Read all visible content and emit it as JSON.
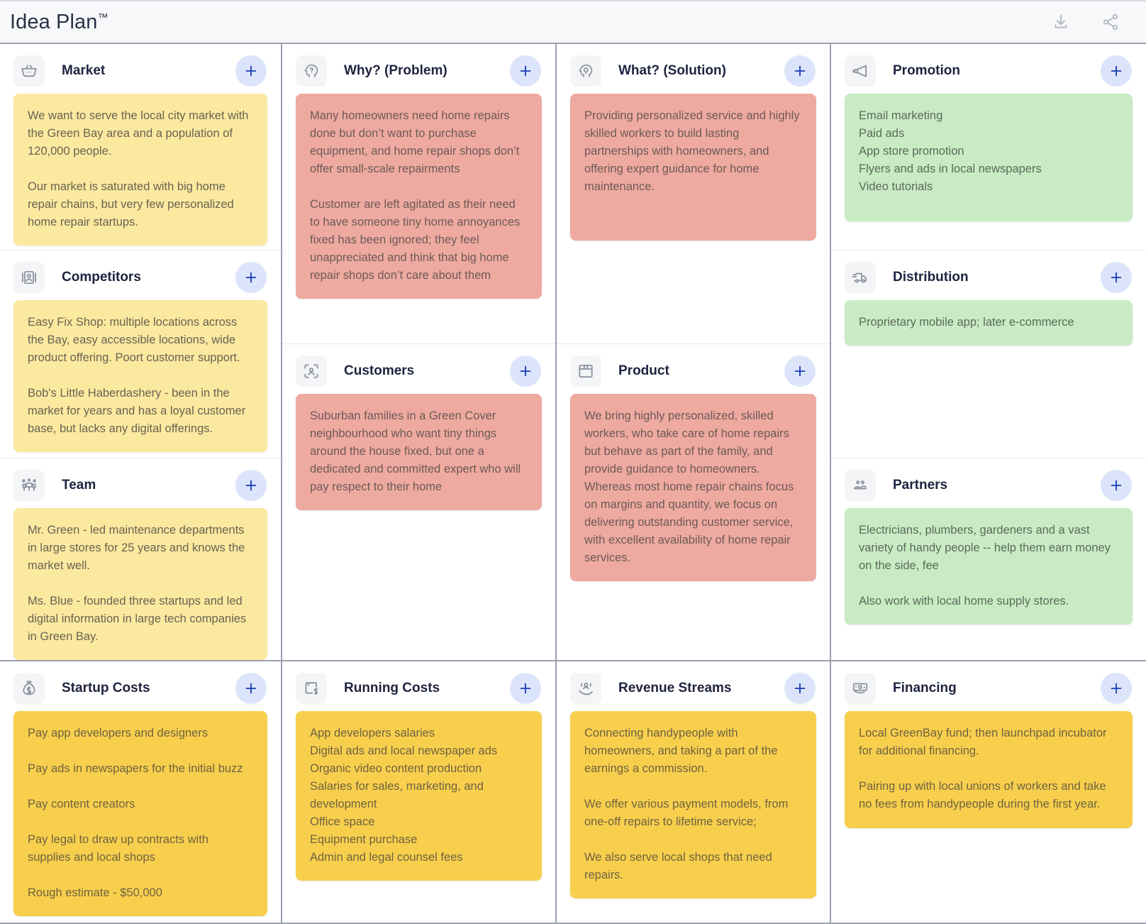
{
  "header": {
    "title": "Idea Plan",
    "trademark": "™",
    "actions": [
      {
        "name": "download-icon",
        "label": "Download"
      },
      {
        "name": "share-icon",
        "label": "Share"
      }
    ]
  },
  "add_button_label": "+",
  "colors": {
    "yellow_note": "#fbe9a0",
    "red_note": "#eeaaa0",
    "green_note": "#c8ebc4",
    "gold_note": "#f8cf4d",
    "add_button_bg": "#dbe4fa",
    "add_button_fg": "#1b3bb5",
    "title_text": "#1e2340",
    "page_bg": "#f7f8fa",
    "grid_line": "#9ba0ae"
  },
  "columns": [
    {
      "id": "col-1",
      "sections": [
        {
          "id": "market",
          "title": "Market",
          "icon": "basket-icon",
          "note_color": "yellow",
          "note": "We want to serve the local city market with the Green Bay area and a population of 120,000 people.\n\nOur market is saturated with big home repair chains, but very few personalized home repair startups."
        },
        {
          "id": "competitors",
          "title": "Competitors",
          "icon": "id-card-icon",
          "note_color": "yellow",
          "note": "Easy Fix Shop: multiple locations across the Bay, easy accessible locations, wide product offering. Poort customer support.\n\nBob's Little Haberdashery - been in the market for years and has a loyal customer base, but lacks any digital offerings."
        },
        {
          "id": "team",
          "title": "Team",
          "icon": "team-icon",
          "note_color": "yellow",
          "note": "Mr. Green - led maintenance departments in large stores for 25 years and knows the market well.\n\nMs. Blue - founded three startups and led digital information in large tech companies in Green Bay."
        }
      ]
    },
    {
      "id": "col-2",
      "sections": [
        {
          "id": "why-problem",
          "title": "Why? (Problem)",
          "icon": "head-question-icon",
          "note_color": "red",
          "note": "Many homeowners need home repairs done but don’t want to purchase equipment, and home repair shops don’t offer small-scale repairments\n\nCustomer are left agitated as their need to have someone tiny home annoyances fixed has been ignored; they feel unappreciated and think that big home repair shops don’t care about them"
        },
        {
          "id": "customers",
          "title": "Customers",
          "icon": "customer-scan-icon",
          "note_color": "red",
          "note": "Suburban families in a Green Cover neighbourhood who want tiny things around the house fixed, but one a dedicated and committed expert who will pay respect to their home"
        }
      ]
    },
    {
      "id": "col-3",
      "sections": [
        {
          "id": "what-solution",
          "title": "What? (Solution)",
          "icon": "head-idea-icon",
          "note_color": "red",
          "note": "Providing personalized service and highly skilled workers to build lasting partnerships with homeowners, and offering expert guidance for home maintenance."
        },
        {
          "id": "product",
          "title": "Product",
          "icon": "box-icon",
          "note_color": "red",
          "note": "We bring highly personalized, skilled workers, who take care of home repairs but behave as part of the family, and provide guidance to homeowners. Whereas most home repair chains focus on margins and quantity, we focus on delivering outstanding customer service, with excellent availability of home repair services."
        }
      ]
    },
    {
      "id": "col-4",
      "sections": [
        {
          "id": "promotion",
          "title": "Promotion",
          "icon": "megaphone-icon",
          "note_color": "green",
          "note": "Email marketing\nPaid ads\nApp store promotion\nFlyers and ads in local newspapers\nVideo tutorials"
        },
        {
          "id": "distribution",
          "title": "Distribution",
          "icon": "truck-icon",
          "note_color": "green",
          "note": "Proprietary mobile app; later e-commerce"
        },
        {
          "id": "partners",
          "title": "Partners",
          "icon": "partners-icon",
          "note_color": "green",
          "note": "Electricians, plumbers, gardeners and a vast variety of handy people -- help them earn money on the side, fee\n\nAlso work with local home supply stores."
        }
      ]
    }
  ],
  "bottom_columns": [
    {
      "id": "startup-costs",
      "title": "Startup Costs",
      "icon": "money-bag-icon",
      "note_color": "gold",
      "note": "Pay app developers and designers\n\nPay ads in newspapers for the initial buzz\n\nPay content creators\n\nPay legal to draw up contracts with supplies and local shops\n\nRough estimate - $50,000"
    },
    {
      "id": "running-costs",
      "title": "Running Costs",
      "icon": "receipt-dollar-icon",
      "note_color": "gold",
      "note": "App developers salaries\nDigital ads and local newspaper ads\nOrganic video content production\nSalaries for sales, marketing, and development\nOffice space\nEquipment purchase\nAdmin and legal counsel fees"
    },
    {
      "id": "revenue-streams",
      "title": "Revenue Streams",
      "icon": "revenue-hand-icon",
      "note_color": "gold",
      "note": "Connecting handypeople with homeowners, and taking a part of the earnings a commission.\n\nWe offer various payment models, from one-off repairs to lifetime service;\n\nWe also serve local shops that need repairs."
    },
    {
      "id": "financing",
      "title": "Financing",
      "icon": "banknote-icon",
      "note_color": "gold",
      "note": "Local GreenBay fund; then launchpad incubator for additional financing.\n\nPairing up with local unions of workers and take no fees from handypeople during the first year."
    }
  ]
}
